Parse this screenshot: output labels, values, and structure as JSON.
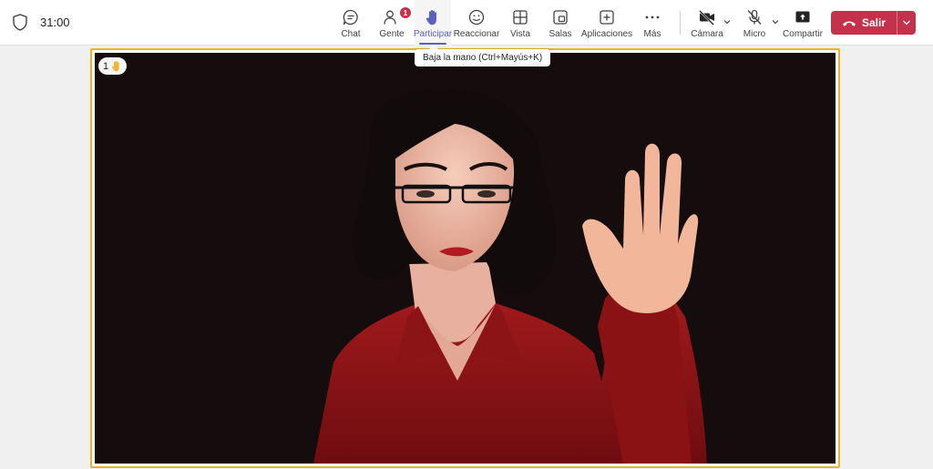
{
  "meeting": {
    "timer": "31:00"
  },
  "toolbar": {
    "chat": {
      "label": "Chat",
      "icon": "chat-icon"
    },
    "people": {
      "label": "Gente",
      "icon": "people-icon",
      "badge": "1"
    },
    "participate": {
      "label": "Participar",
      "icon": "raise-hand-icon",
      "active": true
    },
    "react": {
      "label": "Reaccionar",
      "icon": "emoji-icon"
    },
    "view": {
      "label": "Vista",
      "icon": "grid-icon"
    },
    "rooms": {
      "label": "Salas",
      "icon": "rooms-icon"
    },
    "apps": {
      "label": "Aplicaciones",
      "icon": "add-app-icon"
    },
    "more": {
      "label": "Más",
      "icon": "more-icon"
    },
    "camera": {
      "label": "Cámara",
      "icon": "camera-off-icon"
    },
    "mic": {
      "label": "Micro",
      "icon": "mic-off-icon"
    },
    "share": {
      "label": "Compartir",
      "icon": "share-icon"
    },
    "leave": {
      "label": "Salir",
      "icon": "hang-up-icon"
    }
  },
  "tooltip": {
    "text": "Baja la mano (Ctrl+Mayús+K)"
  },
  "video": {
    "raised_hands": "1"
  },
  "colors": {
    "accent": "#5b5fc7",
    "leave": "#c4314b",
    "video_border": "#e8b523",
    "badge": "#c4314b"
  }
}
